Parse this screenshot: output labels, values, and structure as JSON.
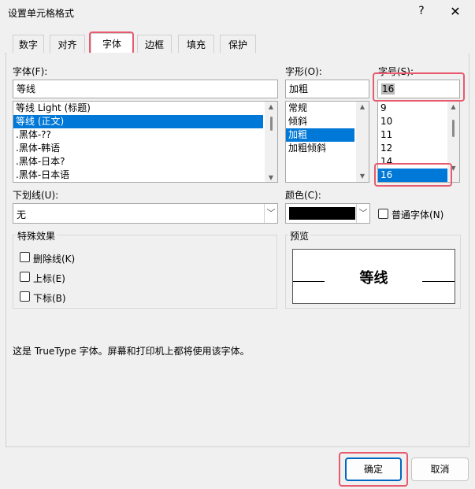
{
  "window": {
    "title": "设置单元格格式",
    "help_label": "?",
    "close_label": "✕"
  },
  "tabs": [
    {
      "label": "数字"
    },
    {
      "label": "对齐"
    },
    {
      "label": "字体"
    },
    {
      "label": "边框"
    },
    {
      "label": "填充"
    },
    {
      "label": "保护"
    }
  ],
  "font": {
    "label": "字体(F):",
    "value": "等线",
    "items": [
      "等线 Light (标题)",
      "等线 (正文)",
      ".黑体-??",
      ".黑体-韩语",
      ".黑体-日本?",
      ".黑体-日本语"
    ],
    "selected_index": 1
  },
  "style": {
    "label": "字形(O):",
    "value": "加粗",
    "items": [
      "常规",
      "倾斜",
      "加粗",
      "加粗倾斜"
    ],
    "selected_index": 2
  },
  "size": {
    "label": "字号(S):",
    "value": "16",
    "items": [
      "9",
      "10",
      "11",
      "12",
      "14",
      "16"
    ],
    "selected_index": 5
  },
  "underline": {
    "label": "下划线(U):",
    "value": "无"
  },
  "color": {
    "label": "颜色(C):",
    "swatch": "#000000",
    "normal_font_label": "普通字体(N)"
  },
  "effects": {
    "group_label": "特殊效果",
    "strikethrough": "删除线(K)",
    "superscript": "上标(E)",
    "subscript": "下标(B)"
  },
  "preview": {
    "group_label": "预览",
    "sample": "等线"
  },
  "info_text": "这是 TrueType 字体。屏幕和打印机上都将使用该字体。",
  "buttons": {
    "ok": "确定",
    "cancel": "取消"
  },
  "colors": {
    "accent": "#0078d7",
    "highlight": "#e85a6e"
  }
}
